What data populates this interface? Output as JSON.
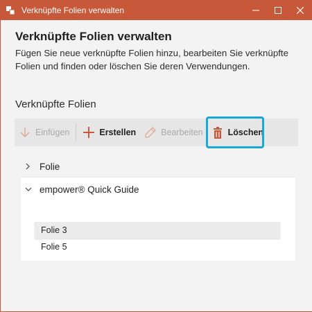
{
  "window": {
    "title": "Verknüpfte Folien verwalten",
    "accent_color": "#c8583a",
    "controls": [
      "minimize-icon",
      "maximize-icon",
      "close-icon"
    ]
  },
  "header": {
    "title": "Verknüpfte Folien verwalten",
    "description": "Fügen Sie neue verknüpfte Folien hinzu, bearbeiten Sie verknüpfte Folien und finden oder löschen Sie deren Verwendungen."
  },
  "section": {
    "title": "Verknüpfte Folien"
  },
  "toolbar": {
    "insert_label": "Einfügen",
    "create_label": "Erstellen",
    "edit_label": "Bearbeiten",
    "delete_label": "Löschen",
    "highlight_color": "#1aa6d8"
  },
  "tree": {
    "groups": [
      {
        "label": "Folie",
        "expanded": false,
        "items": []
      },
      {
        "label": "empower® Quick Guide",
        "expanded": true,
        "items": [
          {
            "label": "Folie 3",
            "selected": true
          },
          {
            "label": "Folie 5",
            "selected": false
          }
        ]
      }
    ]
  }
}
